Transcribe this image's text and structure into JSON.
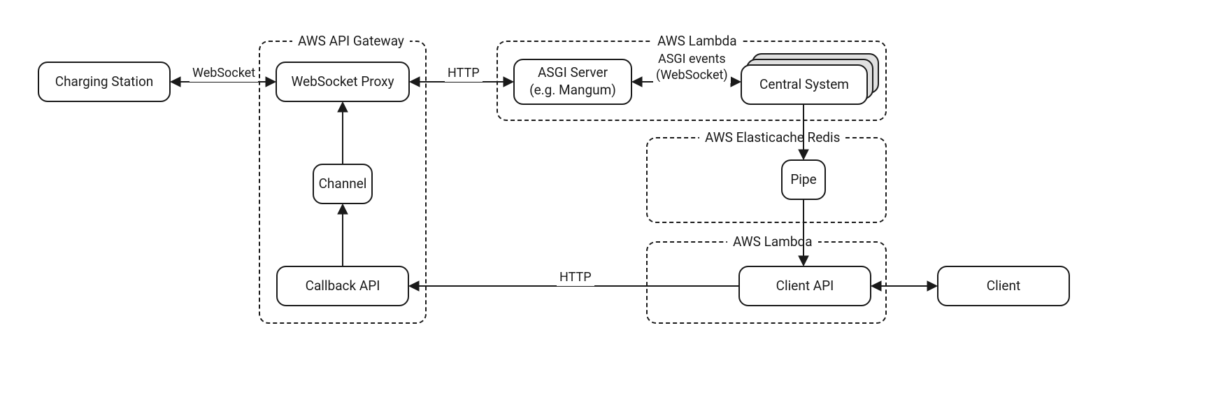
{
  "nodes": {
    "charging_station": "Charging Station",
    "websocket_proxy": "WebSocket Proxy",
    "channel": "Channel",
    "callback_api": "Callback API",
    "asgi_server": "ASGI Server\n(e.g. Mangum)",
    "central_system": "Central System",
    "pipe": "Pipe",
    "client_api": "Client API",
    "client": "Client"
  },
  "groups": {
    "aws_api_gateway": "AWS API Gateway",
    "aws_lambda_top": "AWS Lambda",
    "aws_elasticache": "AWS Elasticache Redis",
    "aws_lambda_bottom": "AWS Lambda"
  },
  "edges": {
    "websocket": "WebSocket",
    "http_top": "HTTP",
    "asgi_events": "ASGI events\n(WebSocket)",
    "http_bottom": "HTTP"
  }
}
